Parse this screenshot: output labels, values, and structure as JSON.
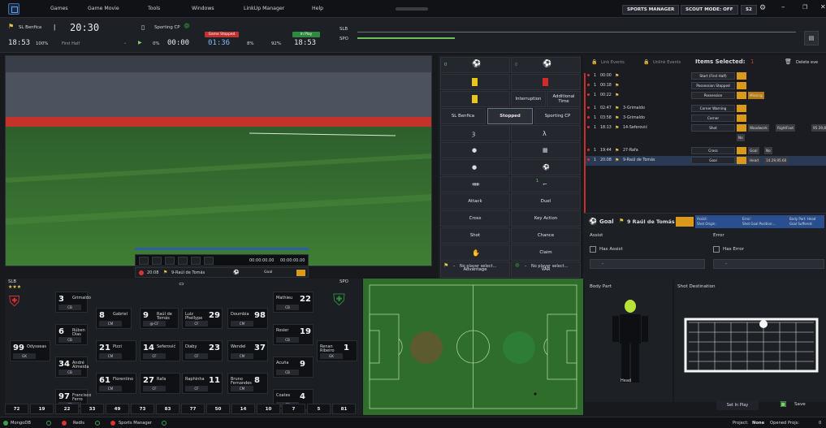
{
  "menu": {
    "items": [
      "Games",
      "Game Movie",
      "Tools",
      "Windows",
      "LinkUp Manager",
      "Help"
    ],
    "sports_manager": "SPORTS MANAGER",
    "scout_mode": "SCOUT MODE: OFF",
    "season": "S2"
  },
  "header": {
    "home": "SL Benfica",
    "away": "Sporting CP",
    "clock": "20:30",
    "home_time": "18:53",
    "pct_home": "100%",
    "half": "First Half",
    "pct": "0%",
    "away_clock": "00:00",
    "stopped_label": "Game Stopped",
    "stopped_time": "01:36",
    "pct_a": "8%",
    "pct_b": "92%",
    "inplay_label": "In Play",
    "inplay_time": "18:53",
    "slb": "SLB",
    "spo": "SPO"
  },
  "video": {
    "timecode_a": "00:00:00.00",
    "timecode_b": "00:00:00.00",
    "event_time": "20:08",
    "event_player": "9-Raúl de Tomás",
    "event_type": "Goal"
  },
  "mid": {
    "interruption": "Interruption",
    "additional_time": "Additional Time",
    "home": "SL Benfica",
    "status": "Stopped",
    "away": "Sporting CP",
    "attack": "Attack",
    "duel": "Duel",
    "cross": "Cross",
    "key_action": "Key Action",
    "shot": "Shot",
    "chance": "Chance",
    "claim": "Claim",
    "advantage": "Advantage",
    "var": "VAR",
    "no_player_a": "No player select...",
    "no_player_b": "No player select..."
  },
  "events": {
    "link": "Link Events",
    "unlink": "Unlink Events",
    "selected": "Items Selected:",
    "selected_count": "1",
    "delete": "Delete eve",
    "rows": [
      {
        "num": "1",
        "time": "00:00",
        "player": "",
        "type": "Start (First Half)",
        "tags": []
      },
      {
        "num": "1",
        "time": "00:18",
        "player": "",
        "type": "Possession Stopped",
        "tags": []
      },
      {
        "num": "1",
        "time": "00:22",
        "player": "",
        "type": "Possession",
        "tags": [
          "Missing"
        ]
      },
      {
        "num": "1",
        "time": "02:47",
        "player": "3-Grimaldo",
        "type": "Corner Warning",
        "tags": []
      },
      {
        "num": "1",
        "time": "03:58",
        "player": "3-Grimaldo",
        "type": "Corner",
        "tags": []
      },
      {
        "num": "1",
        "time": "18:13",
        "player": "14-Seferović",
        "type": "Shot",
        "tags": [
          "Woodwork",
          "RightFoot",
          "95.39,81.87"
        ]
      },
      {
        "num": "",
        "time": "",
        "player": "",
        "type": "",
        "tags": [
          "No"
        ]
      },
      {
        "num": "1",
        "time": "19:44",
        "player": "27-Rafa",
        "type": "Cross",
        "tags": [
          "Goal",
          "No"
        ]
      },
      {
        "num": "1",
        "time": "20:08",
        "player": "9-Raúl de Tomás",
        "type": "Goal",
        "tags": [
          "Head",
          "14.29,95.60"
        ]
      }
    ]
  },
  "goal": {
    "title": "Goal",
    "player": "9 Raúl de Tomás",
    "assist_lbl": "Assist:",
    "shot_origin": "Shot Origin:",
    "error_lbl": "Error:",
    "shot_goal_pos": "Shot Goal Position:...",
    "body_part_lbl": "Body Part: Head",
    "goal_suffered": "Goal Suffered:",
    "assist": "Assist",
    "error": "Error",
    "has_assist": "Has Assist",
    "has_error": "Has Error"
  },
  "lineup": {
    "slb": "SLB",
    "spo": "SPO",
    "home": [
      {
        "n": "3",
        "name": "Grimaldo",
        "pos": "CB"
      },
      {
        "n": "8",
        "name": "Gabriel",
        "pos": "CM"
      },
      {
        "n": "9",
        "name": "Raúl de Tomás",
        "pos": "@-CF"
      },
      {
        "n": "6",
        "name": "Rúben Dias",
        "pos": "CB"
      },
      {
        "n": "99",
        "name": "Odysseas",
        "pos": "GK"
      },
      {
        "n": "21",
        "name": "Pizzi",
        "pos": "CM"
      },
      {
        "n": "14",
        "name": "Seferović",
        "pos": "CF"
      },
      {
        "n": "34",
        "name": "André Almeida",
        "pos": "CB"
      },
      {
        "n": "61",
        "name": "Florentino",
        "pos": "CM"
      },
      {
        "n": "27",
        "name": "Rafa",
        "pos": "CF"
      },
      {
        "n": "97",
        "name": "Francisco Ferro",
        "pos": "CB"
      }
    ],
    "away": [
      {
        "n": "29",
        "name": "Luiz Phellype",
        "pos": "CF"
      },
      {
        "n": "98",
        "name": "Doumbia",
        "pos": "CM"
      },
      {
        "n": "22",
        "name": "Mathieu",
        "pos": "CB"
      },
      {
        "n": "19",
        "name": "Rosier",
        "pos": "CB"
      },
      {
        "n": "23",
        "name": "Diaby",
        "pos": "CF"
      },
      {
        "n": "37",
        "name": "Wendel",
        "pos": "CM"
      },
      {
        "n": "1",
        "name": "Renan Ribeiro",
        "pos": "GK"
      },
      {
        "n": "11",
        "name": "Raphinha",
        "pos": "CF"
      },
      {
        "n": "8",
        "name": "Bruno Fernandes",
        "pos": "CM"
      },
      {
        "n": "9",
        "name": "Acuña",
        "pos": "CB"
      },
      {
        "n": "4",
        "name": "Coates",
        "pos": "CB"
      }
    ],
    "bench": [
      "72",
      "19",
      "22",
      "33",
      "49",
      "73",
      "83",
      "77",
      "50",
      "14",
      "10",
      "7",
      "5",
      "81"
    ]
  },
  "body": {
    "title": "Body Part",
    "selected": "Head"
  },
  "shot": {
    "title": "Shot Destination",
    "set_in_play": "Set In Play",
    "save": "Save"
  },
  "status": {
    "mongo": "MongoDB",
    "redis": "Redis",
    "sm": "Sports Manager",
    "project_lbl": "Project:",
    "project": "None",
    "opened_lbl": "Opened Projs:",
    "opened": "0"
  },
  "colors": {
    "accent_red": "#d93434",
    "accent_orange": "#d99a1c",
    "green": "#2e8a3c",
    "blue": "#2a5fa8"
  }
}
